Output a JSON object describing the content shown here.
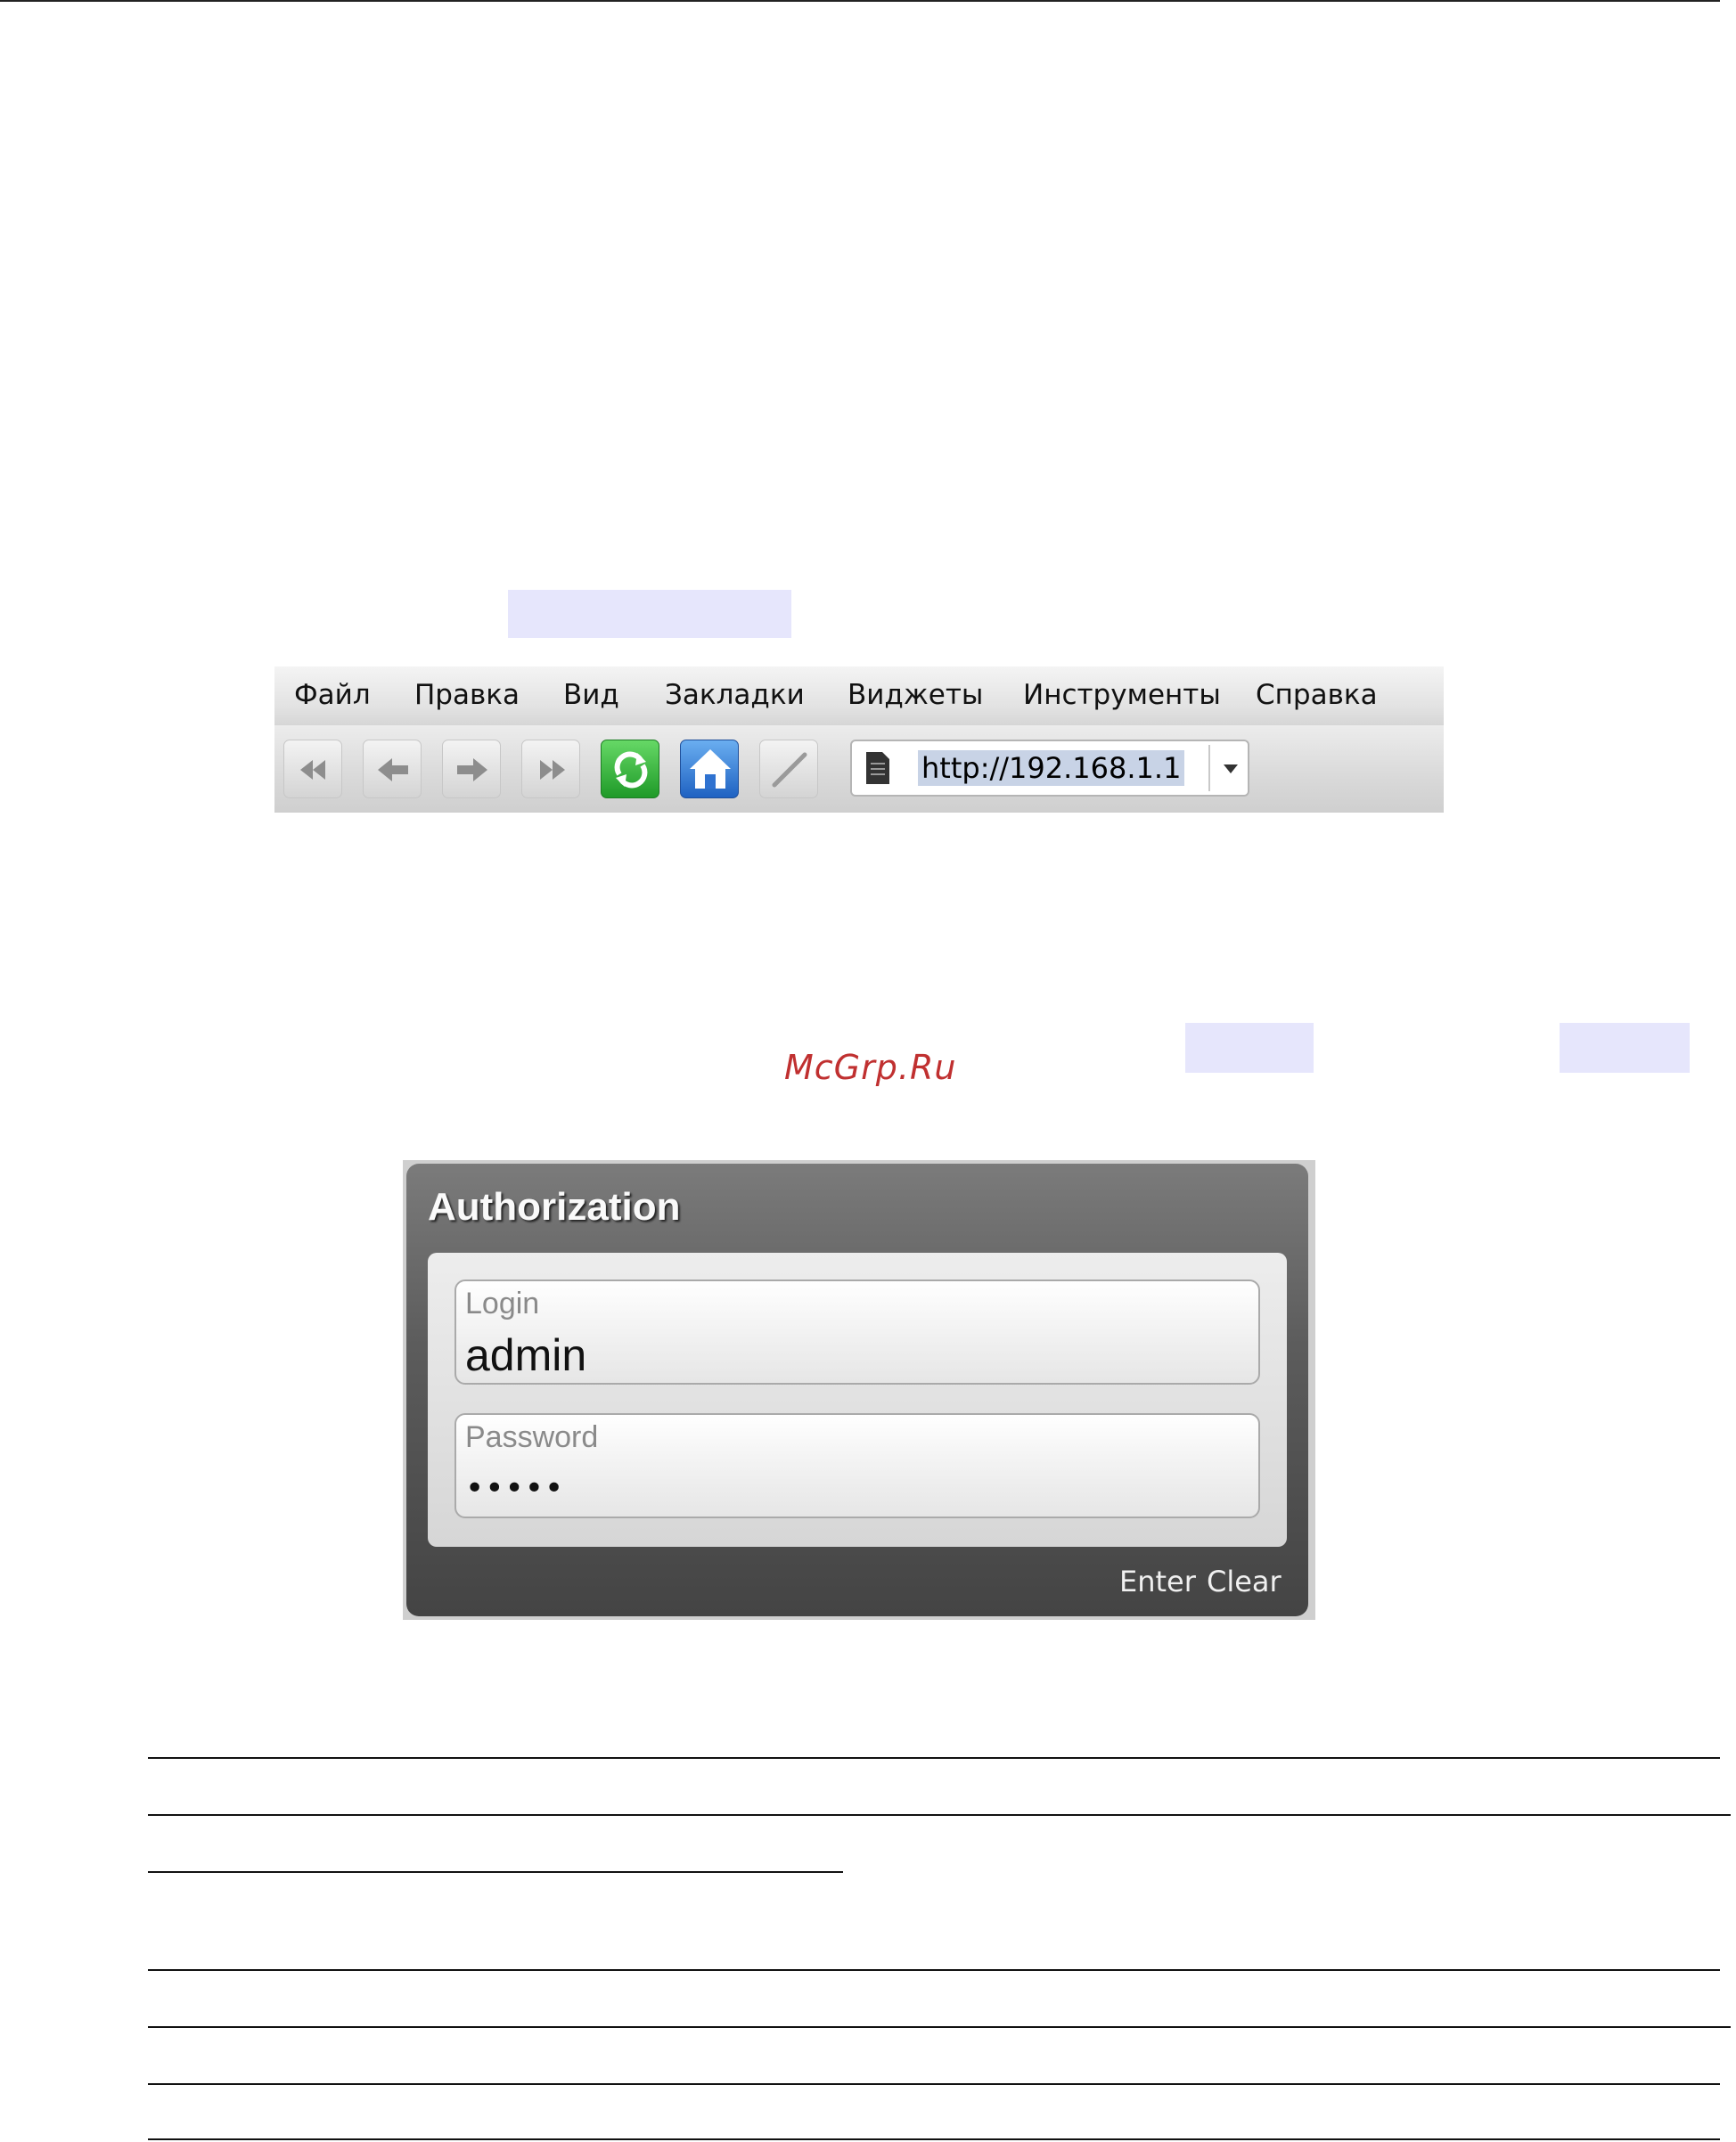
{
  "browser": {
    "menu": [
      "Файл",
      "Правка",
      "Вид",
      "Закладки",
      "Виджеты",
      "Инструменты",
      "Справка"
    ],
    "toolbar": {
      "buttons": [
        "rewind-icon",
        "back-arrow-icon",
        "forward-arrow-icon",
        "fast-forward-icon",
        "reload-icon",
        "home-icon",
        "edit-pen-icon"
      ],
      "address": "http://192.168.1.1"
    }
  },
  "watermark": "McGrp.Ru",
  "auth": {
    "title": "Authorization",
    "login_label": "Login",
    "login_value": "admin",
    "password_label": "Password",
    "password_value": "•••••",
    "enter_label": "Enter",
    "clear_label": "Clear"
  },
  "colors": {
    "highlight": "#e6e6fc",
    "watermark": "#c03030",
    "reload": "#2da836",
    "home": "#2f72d0"
  }
}
